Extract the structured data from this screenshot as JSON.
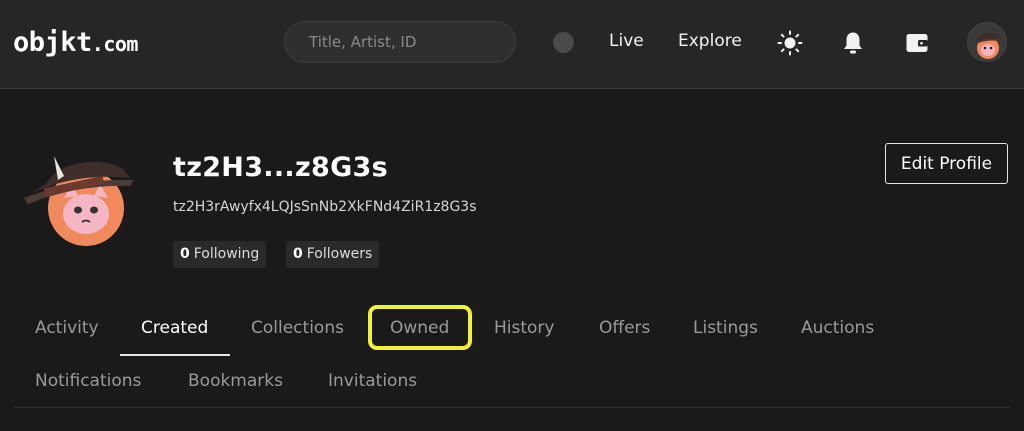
{
  "header": {
    "logo_main": "objkt",
    "logo_domain": ".com",
    "search_placeholder": "Title, Artist, ID",
    "nav": {
      "live": "Live",
      "explore": "Explore"
    },
    "icons": [
      "status-dot-icon",
      "sun-icon",
      "bell-icon",
      "wallet-icon",
      "avatar"
    ]
  },
  "profile": {
    "display_name": "tz2H3...z8G3s",
    "address": "tz2H3rAwyfx4LQJsSnNb2XkFNd4ZiR1z8G3s",
    "following_count": "0",
    "following_label": "Following",
    "followers_count": "0",
    "followers_label": "Followers",
    "edit_label": "Edit Profile"
  },
  "tabs": {
    "row1": [
      "Activity",
      "Created",
      "Collections",
      "Owned",
      "History",
      "Offers",
      "Listings",
      "Auctions"
    ],
    "row2": [
      "Notifications",
      "Bookmarks",
      "Invitations"
    ],
    "active": "Created",
    "highlighted": "Owned"
  },
  "colors": {
    "background": "#1a1a1a",
    "header": "#262626",
    "highlight": "#f3f03a",
    "avatar_face": "#f08a5d",
    "avatar_hat": "#3d2e2a"
  }
}
